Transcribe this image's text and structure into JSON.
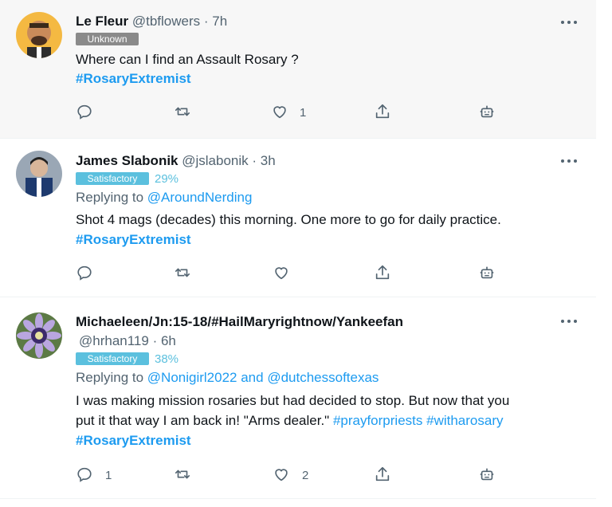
{
  "colors": {
    "link": "#1d9bf0",
    "badge_unknown": "#8a8a8a",
    "badge_satisfactory": "#5bc0de"
  },
  "tweets": [
    {
      "name": "Le Fleur",
      "handle": "@tbflowers",
      "time": "· 7h",
      "badge": "Unknown",
      "text": "Where can I find an Assault Rosary ?",
      "hashtag": "#RosaryExtremist",
      "reply_count": "",
      "like_count": "1"
    },
    {
      "name": "James Slabonik",
      "handle": "@jslabonik",
      "time": "· 3h",
      "badge": "Satisfactory",
      "badge_pct": "29%",
      "replying_label": "Replying to",
      "replying_to": "@AroundNerding",
      "text": "Shot 4 mags (decades) this morning.  One more to go for daily practice.",
      "hashtag": "#RosaryExtremist"
    },
    {
      "name": "Michaeleen/Jn:15-18/#HailMaryrightnow/Yankeefan",
      "handle": "@hrhan119",
      "time": "· 6h",
      "badge": "Satisfactory",
      "badge_pct": "38%",
      "replying_label": "Replying to",
      "replying_to": "@Nonigirl2022 and @dutchessoftexas",
      "text_line1": "I was making mission rosaries but had decided to stop.  But now that you",
      "text_line2": "put it that way I am back in!  \"Arms dealer.\"",
      "tag1": "#prayforpriests",
      "tag2": "#witharosary",
      "hashtag": "#RosaryExtremist",
      "reply_count": "1",
      "like_count": "2"
    }
  ]
}
